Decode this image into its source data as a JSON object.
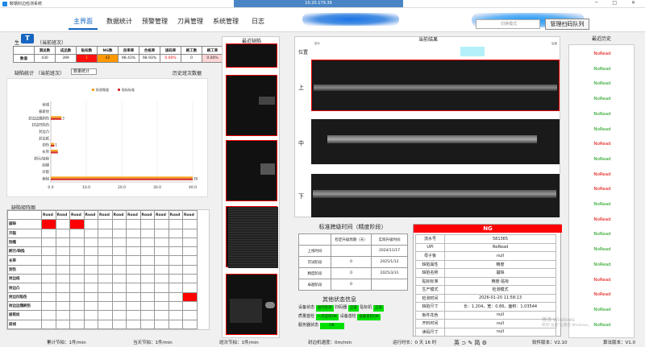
{
  "window": {
    "title": "鞍钢封边检测系统",
    "remote_host": "10.20.179.39",
    "controls": "─ □ ✕"
  },
  "menu": [
    {
      "label": "主界面",
      "active": true
    },
    {
      "label": "数据统计"
    },
    {
      "label": "预警管理"
    },
    {
      "label": "刀具管理"
    },
    {
      "label": "系统管理"
    },
    {
      "label": "日志"
    }
  ],
  "scan": {
    "placeholder": "切换模式",
    "button": "管理扫码队列"
  },
  "stats": {
    "title_prefix": "生",
    "title": "（当前班次）",
    "headers": [
      "",
      "测总数",
      "成品数",
      "贴标数",
      "NG数",
      "良率率",
      "合格率",
      "读码率",
      "刷工数",
      "刷工率"
    ],
    "row_label": "数值",
    "values": [
      "430",
      "399",
      "1",
      "42",
      "98.43%",
      "98.93%",
      "0.00%",
      "0",
      "0.00%"
    ]
  },
  "defect_stats": {
    "title": "缺陷统计",
    "sub": "（当前班次）",
    "dropdown": "数量统计",
    "history_link": "历史班次数据"
  },
  "chart_data": {
    "type": "bar",
    "orientation": "horizontal",
    "legend_position": "top",
    "categories": [
      "前线",
      "披斑纹",
      "封边边翘刷伤",
      "封边凹陷伤",
      "封边凸",
      "封边纸",
      "划伤",
      "长带",
      "刷污/缺陷",
      "刮缝",
      "开裂",
      "崩缺"
    ],
    "series": [
      {
        "name": "检测频道",
        "color": "#f7a21b",
        "values": [
          0,
          0,
          3,
          0,
          0,
          0,
          1,
          2,
          0,
          0,
          0,
          43
        ]
      },
      {
        "name": "贴标标准",
        "color": "#d32f2f",
        "values": [
          0,
          0,
          3,
          0,
          0,
          0,
          1,
          2,
          0,
          0,
          0,
          43
        ]
      }
    ],
    "data_labels": [
      "",
      "",
      "3",
      "",
      "",
      "",
      "1",
      "",
      "",
      "",
      "",
      "38"
    ],
    "xlim": [
      0,
      40
    ],
    "xticks": [
      "0.0",
      "10.0",
      "20.0",
      "30.0",
      "40.0"
    ]
  },
  "matrix": {
    "title": "缺陷矩阵图",
    "col_header": "Road",
    "rows": [
      {
        "label": "崩缺",
        "red": [
          0,
          2
        ]
      },
      {
        "label": "开裂",
        "red": []
      },
      {
        "label": "刮缝",
        "red": []
      },
      {
        "label": "刷污/缺陷",
        "red": []
      },
      {
        "label": "长带",
        "red": []
      },
      {
        "label": "划伤",
        "red": []
      },
      {
        "label": "封边纸",
        "red": []
      },
      {
        "label": "封边凸",
        "red": []
      },
      {
        "label": "封边凹陷伤",
        "red": [
          10
        ]
      },
      {
        "label": "封边边翘刷伤",
        "red": []
      },
      {
        "label": "披斑纹",
        "red": []
      },
      {
        "label": "前线",
        "red": []
      }
    ],
    "cols": 11
  },
  "recent_defects": {
    "title": "最近缺陷"
  },
  "current_result": {
    "title": "当前结果",
    "position_label": "位置",
    "rows": [
      "上",
      "中",
      "下"
    ],
    "tiny_left": "前头",
    "tiny_right": "后面"
  },
  "history": {
    "title": "最近历史",
    "items": [
      "NoRead",
      "NoRead",
      "NoRead",
      "NoRead",
      "NoRead",
      "NoRead",
      "NoRead",
      "NoRead",
      "NoRead",
      "NoRead",
      "NoRead",
      "NoRead",
      "NoRead",
      "NoRead",
      "NoRead",
      "NoRead",
      "NoRead",
      "NoRead",
      "NoRead"
    ],
    "colors": [
      "red",
      "green",
      "green",
      "green",
      "green",
      "green",
      "red",
      "green",
      "red",
      "red",
      "green",
      "red",
      "green",
      "green",
      "green",
      "red",
      "red",
      "green",
      "green"
    ]
  },
  "timing": {
    "title": "标准跨级时间（精度阶段）",
    "headers": [
      "",
      "检定升级周期（天）",
      "实际升级时间"
    ],
    "rows": [
      [
        "上线时间",
        "",
        "2024/11/17"
      ],
      [
        "可试阶段",
        "0",
        "2025/1/12"
      ],
      [
        "精度阶段",
        "0",
        "2025/3/31"
      ],
      [
        "卓越阶段",
        "0",
        ""
      ]
    ]
  },
  "status": {
    "title": "其他状态信息",
    "rows": [
      [
        {
          "k": "设备状态",
          "v": "运行检测"
        },
        {
          "k": "扫码器",
          "v": "正常"
        },
        {
          "k": "贴标机",
          "v": "正常"
        }
      ],
      [
        {
          "k": "质量首检",
          "v": "一次首检OK"
        },
        {
          "k": "设备首检",
          "v": "设备首检OK"
        }
      ],
      [
        {
          "k": "服务器状态",
          "v": "OK"
        }
      ]
    ]
  },
  "detail": {
    "result": "NG",
    "rows": [
      [
        "流水号",
        "581365"
      ],
      [
        "UPI",
        "NoRead"
      ],
      [
        "母子板",
        "null"
      ],
      [
        "缺陷属性",
        "精度"
      ],
      [
        "缺陷名称",
        "崩缺"
      ],
      [
        "贴标标准",
        "精度-贴标"
      ],
      [
        "生产模式",
        "检测模式"
      ],
      [
        "检测时间",
        "2026-01-20 11:58:13"
      ],
      [
        "缺陷尺寸",
        "长：1.204，宽：0.86，面积：1.03544"
      ],
      [
        "板件花色",
        "null"
      ],
      [
        "开料时间",
        "null"
      ],
      [
        "读码尺寸",
        "null"
      ]
    ]
  },
  "statusbar": {
    "cumulative": "累计节拍：1件/min",
    "today": "当天节拍：1件/min",
    "shift": "班次节拍：1件/min",
    "speed": "封边机速度：0m/min",
    "runtime": "运行时长：0 天 16 时",
    "ime": "英 ⊃ ✎ 简 ⚙",
    "sw_version": "软件版本：V2.10",
    "algo_version": "算法版本：V1.0"
  },
  "watermark": {
    "line1": "激活 Windows",
    "line2": "转到\"设置\"以激活 Windows。"
  }
}
